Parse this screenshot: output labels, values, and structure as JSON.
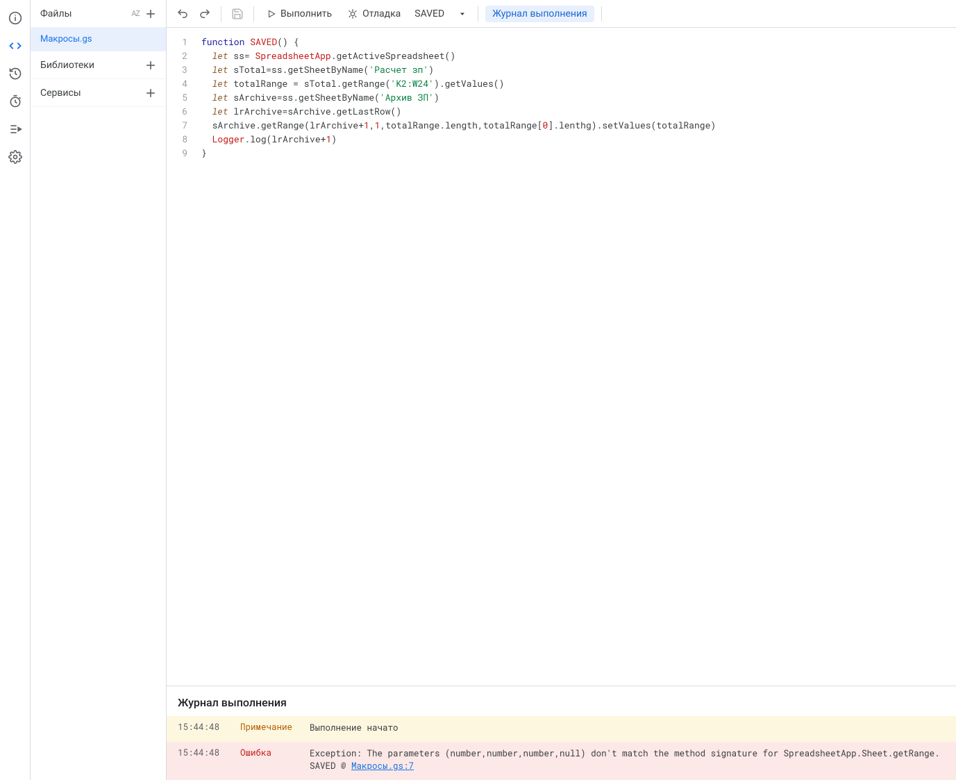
{
  "rail": {
    "items": [
      "info",
      "editor",
      "history",
      "triggers",
      "executions",
      "settings"
    ]
  },
  "sidebar": {
    "files_label": "Файлы",
    "file_name": "Макросы.gs",
    "libraries_label": "Библиотеки",
    "services_label": "Сервисы"
  },
  "toolbar": {
    "run_label": "Выполнить",
    "debug_label": "Отладка",
    "function_selected": "SAVED",
    "exec_log_label": "Журнал выполнения"
  },
  "code": {
    "lines": [
      {
        "n": "1",
        "tokens": [
          {
            "t": "function ",
            "c": "tok-kw"
          },
          {
            "t": "SAVED",
            "c": "tok-fn"
          },
          {
            "t": "() {",
            "c": ""
          }
        ]
      },
      {
        "n": "2",
        "tokens": [
          {
            "t": "  "
          },
          {
            "t": "let",
            "c": "tok-decl"
          },
          {
            "t": " ss= "
          },
          {
            "t": "SpreadsheetApp",
            "c": "tok-fn"
          },
          {
            "t": ".getActiveSpreadsheet()",
            "c": ""
          }
        ]
      },
      {
        "n": "3",
        "tokens": [
          {
            "t": "  "
          },
          {
            "t": "let",
            "c": "tok-decl"
          },
          {
            "t": " sTotal=ss.getSheetByName("
          },
          {
            "t": "'Расчет зп'",
            "c": "tok-str"
          },
          {
            "t": ")"
          }
        ]
      },
      {
        "n": "4",
        "tokens": [
          {
            "t": "  "
          },
          {
            "t": "let",
            "c": "tok-decl"
          },
          {
            "t": " totalRange = sTotal.getRange("
          },
          {
            "t": "'K2:W24'",
            "c": "tok-str"
          },
          {
            "t": ").getValues()"
          }
        ]
      },
      {
        "n": "5",
        "tokens": [
          {
            "t": "  "
          },
          {
            "t": "let",
            "c": "tok-decl"
          },
          {
            "t": " sArchive=ss.getSheetByName("
          },
          {
            "t": "'Архив ЗП'",
            "c": "tok-str"
          },
          {
            "t": ")"
          }
        ]
      },
      {
        "n": "6",
        "tokens": [
          {
            "t": "  "
          },
          {
            "t": "let",
            "c": "tok-decl"
          },
          {
            "t": " lrArchive=sArchive.getLastRow()"
          }
        ]
      },
      {
        "n": "7",
        "tokens": [
          {
            "t": "  sArchive.getRange(lrArchive+"
          },
          {
            "t": "1",
            "c": "tok-num"
          },
          {
            "t": ","
          },
          {
            "t": "1",
            "c": "tok-num"
          },
          {
            "t": ",totalRange.length,totalRange["
          },
          {
            "t": "0",
            "c": "tok-num"
          },
          {
            "t": "].lenthg).setValues(totalRange)"
          }
        ]
      },
      {
        "n": "8",
        "tokens": [
          {
            "t": "  "
          },
          {
            "t": "Logger",
            "c": "tok-fn"
          },
          {
            "t": ".log(lrArchive+"
          },
          {
            "t": "1",
            "c": "tok-num"
          },
          {
            "t": ")"
          }
        ]
      },
      {
        "n": "9",
        "tokens": [
          {
            "t": "}"
          }
        ]
      }
    ]
  },
  "log": {
    "title": "Журнал выполнения",
    "rows": [
      {
        "ts": "15:44:48",
        "level": "Примечание",
        "msg": "Выполнение начато",
        "type": "note"
      },
      {
        "ts": "15:44:48",
        "level": "Ошибка",
        "msg": "Exception: The parameters (number,number,number,null) don't match the method signature for SpreadsheetApp.Sheet.getRange.",
        "link_prefix": "SAVED @ ",
        "link": "Макросы.gs:7",
        "type": "error"
      }
    ]
  }
}
